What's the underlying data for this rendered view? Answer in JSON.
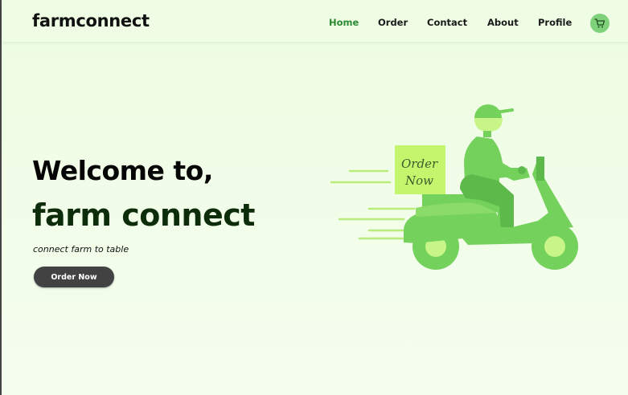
{
  "app": {
    "brand": "farmconnect"
  },
  "nav": {
    "items": [
      {
        "label": "Home",
        "active": true
      },
      {
        "label": "Order",
        "active": false
      },
      {
        "label": "Contact",
        "active": false
      },
      {
        "label": "About",
        "active": false
      },
      {
        "label": "Profile",
        "active": false
      }
    ],
    "cart_icon": "shopping-cart-icon"
  },
  "hero": {
    "line1": "Welcome to,",
    "line2": "farm connect",
    "tagline": "connect farm to table",
    "cta_label": "Order Now",
    "illustration_sign_line1": "Order",
    "illustration_sign_line2": "Now"
  },
  "colors": {
    "accent_green": "#2c8a32",
    "light_green": "#7fd27b",
    "scooter_green": "#74d15b",
    "dark_button": "#424242",
    "background": "#effde4"
  }
}
